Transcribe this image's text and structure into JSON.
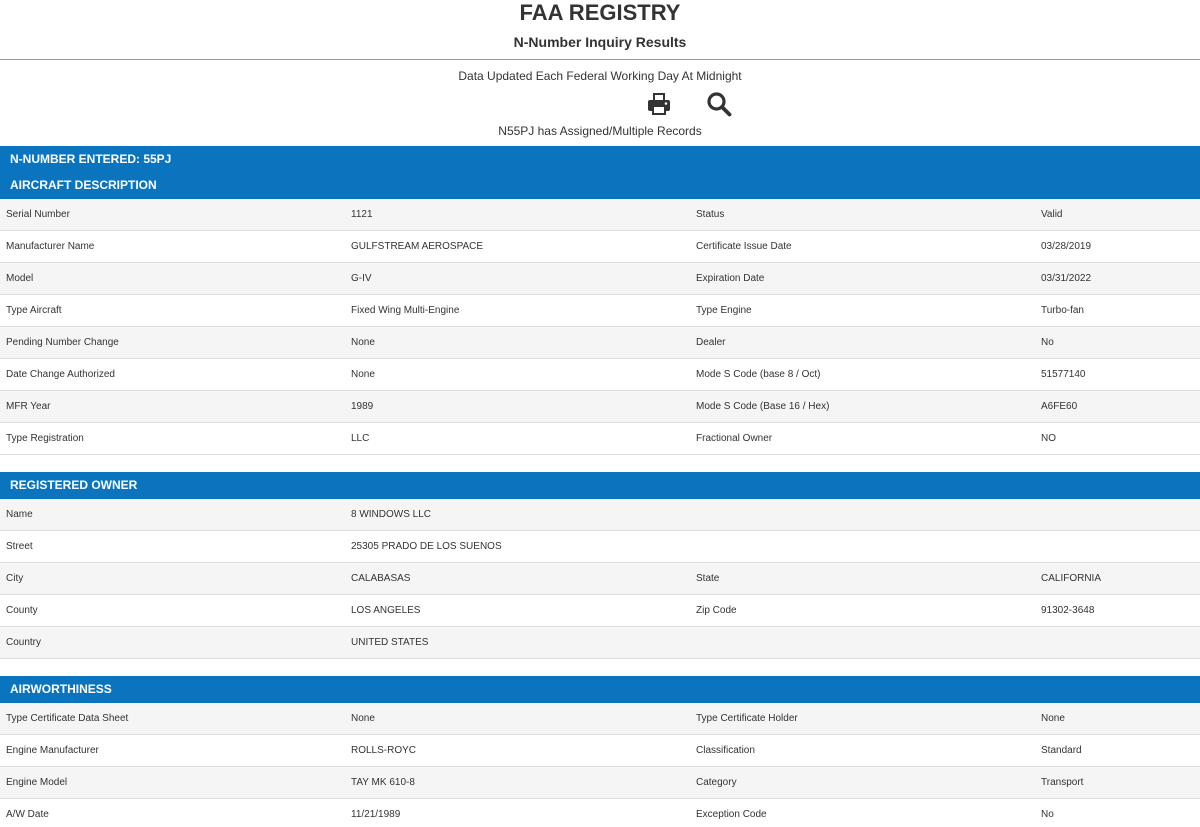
{
  "header": {
    "title": "FAA REGISTRY",
    "subtitle": "N-Number Inquiry Results"
  },
  "info": {
    "updated_text": "Data Updated Each Federal Working Day At Midnight",
    "print_icon": "print-icon",
    "search_icon": "search-icon",
    "records_text": "N55PJ has Assigned/Multiple Records"
  },
  "nnumber_bar": "N-NUMBER ENTERED: 55PJ",
  "aircraft": {
    "heading": "AIRCRAFT DESCRIPTION",
    "rows": [
      [
        "Serial Number",
        "1121",
        "Status",
        "Valid"
      ],
      [
        "Manufacturer Name",
        "GULFSTREAM AEROSPACE",
        "Certificate Issue Date",
        "03/28/2019"
      ],
      [
        "Model",
        "G-IV",
        "Expiration Date",
        "03/31/2022"
      ],
      [
        "Type Aircraft",
        "Fixed Wing Multi-Engine",
        "Type Engine",
        "Turbo-fan"
      ],
      [
        "Pending Number Change",
        "None",
        "Dealer",
        "No"
      ],
      [
        "Date Change Authorized",
        "None",
        "Mode S Code (base 8 / Oct)",
        "51577140"
      ],
      [
        "MFR Year",
        "1989",
        "Mode S Code (Base 16 / Hex)",
        "A6FE60"
      ],
      [
        "Type Registration",
        "LLC",
        "Fractional Owner",
        "NO"
      ]
    ]
  },
  "owner": {
    "heading": "REGISTERED OWNER",
    "rows": [
      [
        "Name",
        "8 WINDOWS LLC",
        "",
        ""
      ],
      [
        "Street",
        "25305 PRADO DE LOS SUENOS",
        "",
        ""
      ],
      [
        "City",
        "CALABASAS",
        "State",
        "CALIFORNIA"
      ],
      [
        "County",
        "LOS ANGELES",
        "Zip Code",
        "91302-3648"
      ],
      [
        "Country",
        "UNITED STATES",
        "",
        ""
      ]
    ]
  },
  "airworthiness": {
    "heading": "AIRWORTHINESS",
    "rows": [
      [
        "Type Certificate Data Sheet",
        "None",
        "Type Certificate Holder",
        "None"
      ],
      [
        "Engine Manufacturer",
        "ROLLS-ROYC",
        "Classification",
        "Standard"
      ],
      [
        "Engine Model",
        "TAY MK 610-8",
        "Category",
        "Transport"
      ],
      [
        "A/W Date",
        "11/21/1989",
        "Exception Code",
        "No"
      ]
    ]
  },
  "colors": {
    "section_blue": "#0b74bf",
    "row_alt": "#f5f5f5"
  }
}
